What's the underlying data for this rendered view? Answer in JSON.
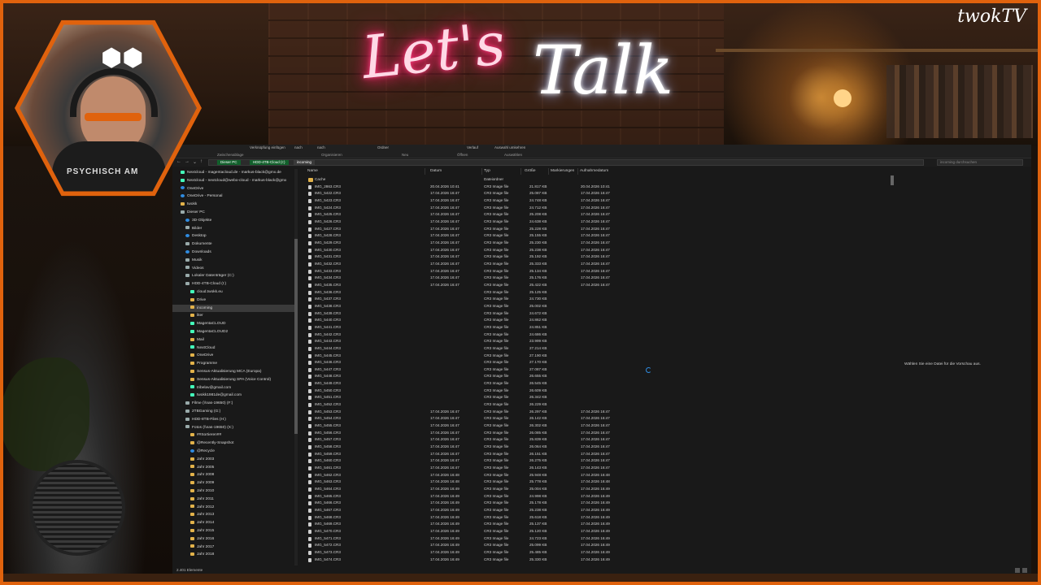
{
  "stream": {
    "title_lets": "Let's",
    "title_talk": "Talk",
    "logo": "twokTV",
    "cam_shirt_text": "PSYCHISCH AM",
    "accent_color": "#e0620d"
  },
  "ribbon": {
    "items": [
      {
        "label": "Verknüpfung einfügen"
      },
      {
        "label": "nach"
      },
      {
        "label": "nach"
      },
      {
        "label": "Ordner"
      },
      {
        "label": "Verlauf"
      },
      {
        "label": "Auswahl umkehren"
      }
    ],
    "groups": [
      {
        "label": "Zwischenablage"
      },
      {
        "label": "Organisieren"
      },
      {
        "label": "Neu"
      },
      {
        "label": "Öffnen"
      },
      {
        "label": "Auswählen"
      }
    ]
  },
  "address": {
    "crumbs": [
      "Dieser PC",
      "HDD-4TB-Cloud (I:)",
      "incoming"
    ],
    "search_placeholder": "incoming durchsuchen"
  },
  "nav": {
    "items": [
      {
        "label": "Nextcloud - magentacloud.de - markus-black@gmx.de",
        "icon": "cloud",
        "indent": 0
      },
      {
        "label": "Nextcloud - nextcloud@webo-cloud - markus-black@gmx",
        "icon": "cloud",
        "indent": 0
      },
      {
        "label": "OneDrive",
        "icon": "blue",
        "indent": 0
      },
      {
        "label": "OneDrive - Personal",
        "icon": "blue",
        "indent": 0
      },
      {
        "label": "twokk",
        "icon": "folder",
        "indent": 0
      },
      {
        "label": "Dieser PC",
        "icon": "drive",
        "indent": 0
      },
      {
        "label": "3D-Objekte",
        "icon": "blue",
        "indent": 1
      },
      {
        "label": "Bilder",
        "icon": "drive",
        "indent": 1
      },
      {
        "label": "Desktop",
        "icon": "blue",
        "indent": 1
      },
      {
        "label": "Dokumente",
        "icon": "drive",
        "indent": 1
      },
      {
        "label": "Downloads",
        "icon": "blue",
        "indent": 1
      },
      {
        "label": "Musik",
        "icon": "drive",
        "indent": 1
      },
      {
        "label": "Videos",
        "icon": "drive",
        "indent": 1
      },
      {
        "label": "Lokaler Datenträger (C:)",
        "icon": "drive",
        "indent": 1
      },
      {
        "label": "HDD-4TB-Cloud (I:)",
        "icon": "drive",
        "indent": 1
      },
      {
        "label": "cloud.twokk.eu",
        "icon": "cloud",
        "indent": 2
      },
      {
        "label": "Drive",
        "icon": "folder",
        "indent": 2
      },
      {
        "label": "incoming",
        "icon": "folder",
        "indent": 2,
        "selected": true
      },
      {
        "label": "liter",
        "icon": "folder",
        "indent": 2
      },
      {
        "label": "MagentaCLOUD",
        "icon": "cloud",
        "indent": 2
      },
      {
        "label": "MagentaCLOUD2",
        "icon": "cloud",
        "indent": 2
      },
      {
        "label": "Mail",
        "icon": "folder",
        "indent": 2
      },
      {
        "label": "NextCloud",
        "icon": "cloud",
        "indent": 2
      },
      {
        "label": "OneDrive",
        "icon": "folder",
        "indent": 2
      },
      {
        "label": "Programme",
        "icon": "folder",
        "indent": 2
      },
      {
        "label": "Sensus-Aktualisierung MCA (Europa)",
        "icon": "folder",
        "indent": 2
      },
      {
        "label": "Sensus-Aktualisierung SPA (Voice Control)",
        "icon": "folder",
        "indent": 2
      },
      {
        "label": "tribelav@gmail.com",
        "icon": "cloud",
        "indent": 2
      },
      {
        "label": "twokk1981de@gmail.com",
        "icon": "cloud",
        "indent": 2
      },
      {
        "label": "Filme (\\\\nas-19650) (F:)",
        "icon": "drive",
        "indent": 1
      },
      {
        "label": "2TBGaming (G:)",
        "icon": "drive",
        "indent": 1
      },
      {
        "label": "HDD-8TB-Files (H:)",
        "icon": "drive",
        "indent": 1
      },
      {
        "label": "Fotos (\\\\nas-19650) (X:)",
        "icon": "drive",
        "indent": 1
      },
      {
        "label": "##Sortieren##",
        "icon": "folder",
        "indent": 2
      },
      {
        "label": "@Recently-Snapshot",
        "icon": "folder",
        "indent": 2
      },
      {
        "label": "@Recycle",
        "icon": "blue",
        "indent": 2
      },
      {
        "label": "Jahr 2003",
        "icon": "folder",
        "indent": 2
      },
      {
        "label": "Jahr 2005",
        "icon": "folder",
        "indent": 2
      },
      {
        "label": "Jahr 2008",
        "icon": "folder",
        "indent": 2
      },
      {
        "label": "Jahr 2009",
        "icon": "folder",
        "indent": 2
      },
      {
        "label": "Jahr 2010",
        "icon": "folder",
        "indent": 2
      },
      {
        "label": "Jahr 2011",
        "icon": "folder",
        "indent": 2
      },
      {
        "label": "Jahr 2012",
        "icon": "folder",
        "indent": 2
      },
      {
        "label": "Jahr 2013",
        "icon": "folder",
        "indent": 2
      },
      {
        "label": "Jahr 2014",
        "icon": "folder",
        "indent": 2
      },
      {
        "label": "Jahr 2015",
        "icon": "folder",
        "indent": 2
      },
      {
        "label": "Jahr 2016",
        "icon": "folder",
        "indent": 2
      },
      {
        "label": "Jahr 2017",
        "icon": "folder",
        "indent": 2
      },
      {
        "label": "Jahr 2018",
        "icon": "folder",
        "indent": 2
      }
    ]
  },
  "columns": [
    "Name",
    "Datum",
    "Typ",
    "Größe",
    "Markierungen",
    "Aufnahmedatum"
  ],
  "files": [
    {
      "name": "Cache",
      "date": "",
      "type": "Dateiordner",
      "size": "",
      "taken": "",
      "folder": true
    },
    {
      "name": "IMG_2863.CR3",
      "date": "20.04.2026 10:41",
      "type": "CR3 Image file",
      "size": "21.817 KB",
      "taken": "20.04.2026 10:41"
    },
    {
      "name": "IMG_5422.CR3",
      "date": "17.04.2026 16:47",
      "type": "CR3 Image file",
      "size": "25.087 KB",
      "taken": "17.04.2026 16:47"
    },
    {
      "name": "IMG_5423.CR3",
      "date": "17.04.2026 16:47",
      "type": "CR3 Image file",
      "size": "24.748 KB",
      "taken": "17.04.2026 16:47"
    },
    {
      "name": "IMG_5424.CR3",
      "date": "17.04.2026 16:47",
      "type": "CR3 Image file",
      "size": "24.712 KB",
      "taken": "17.04.2026 16:47"
    },
    {
      "name": "IMG_5425.CR3",
      "date": "17.04.2026 16:47",
      "type": "CR3 Image file",
      "size": "25.208 KB",
      "taken": "17.04.2026 16:47"
    },
    {
      "name": "IMG_5426.CR3",
      "date": "17.04.2026 16:47",
      "type": "CR3 Image file",
      "size": "24.638 KB",
      "taken": "17.04.2026 16:47"
    },
    {
      "name": "IMG_5427.CR3",
      "date": "17.04.2026 16:47",
      "type": "CR3 Image file",
      "size": "25.228 KB",
      "taken": "17.04.2026 16:47"
    },
    {
      "name": "IMG_5428.CR3",
      "date": "17.04.2026 16:47",
      "type": "CR3 Image file",
      "size": "25.155 KB",
      "taken": "17.04.2026 16:47"
    },
    {
      "name": "IMG_5429.CR3",
      "date": "17.04.2026 16:47",
      "type": "CR3 Image file",
      "size": "25.230 KB",
      "taken": "17.04.2026 16:47"
    },
    {
      "name": "IMG_5430.CR3",
      "date": "17.04.2026 16:47",
      "type": "CR3 Image file",
      "size": "25.238 KB",
      "taken": "17.04.2026 16:47"
    },
    {
      "name": "IMG_5431.CR3",
      "date": "17.04.2026 16:47",
      "type": "CR3 Image file",
      "size": "25.192 KB",
      "taken": "17.04.2026 16:47"
    },
    {
      "name": "IMG_5432.CR3",
      "date": "17.04.2026 16:47",
      "type": "CR3 Image file",
      "size": "25.333 KB",
      "taken": "17.04.2026 16:47"
    },
    {
      "name": "IMG_5433.CR3",
      "date": "17.04.2026 16:47",
      "type": "CR3 Image file",
      "size": "25.134 KB",
      "taken": "17.04.2026 16:47"
    },
    {
      "name": "IMG_5434.CR3",
      "date": "17.04.2026 16:47",
      "type": "CR3 Image file",
      "size": "25.176 KB",
      "taken": "17.04.2026 16:47"
    },
    {
      "name": "IMG_5435.CR3",
      "date": "17.04.2026 16:47",
      "type": "CR3 Image file",
      "size": "25.422 KB",
      "taken": "17.04.2026 16:47"
    },
    {
      "name": "IMG_5436.CR3",
      "date": "",
      "type": "CR3 Image file",
      "size": "25.125 KB",
      "taken": ""
    },
    {
      "name": "IMG_5437.CR3",
      "date": "",
      "type": "CR3 Image file",
      "size": "24.730 KB",
      "taken": ""
    },
    {
      "name": "IMG_5438.CR3",
      "date": "",
      "type": "CR3 Image file",
      "size": "25.002 KB",
      "taken": ""
    },
    {
      "name": "IMG_5439.CR3",
      "date": "",
      "type": "CR3 Image file",
      "size": "24.672 KB",
      "taken": ""
    },
    {
      "name": "IMG_5440.CR3",
      "date": "",
      "type": "CR3 Image file",
      "size": "24.862 KB",
      "taken": ""
    },
    {
      "name": "IMG_5441.CR3",
      "date": "",
      "type": "CR3 Image file",
      "size": "24.851 KB",
      "taken": ""
    },
    {
      "name": "IMG_5442.CR3",
      "date": "",
      "type": "CR3 Image file",
      "size": "24.686 KB",
      "taken": ""
    },
    {
      "name": "IMG_5443.CR3",
      "date": "",
      "type": "CR3 Image file",
      "size": "23.999 KB",
      "taken": ""
    },
    {
      "name": "IMG_5444.CR3",
      "date": "",
      "type": "CR3 Image file",
      "size": "27.214 KB",
      "taken": ""
    },
    {
      "name": "IMG_5445.CR3",
      "date": "",
      "type": "CR3 Image file",
      "size": "27.190 KB",
      "taken": ""
    },
    {
      "name": "IMG_5446.CR3",
      "date": "",
      "type": "CR3 Image file",
      "size": "27.170 KB",
      "taken": ""
    },
    {
      "name": "IMG_5447.CR3",
      "date": "",
      "type": "CR3 Image file",
      "size": "27.087 KB",
      "taken": ""
    },
    {
      "name": "IMG_5448.CR3",
      "date": "",
      "type": "CR3 Image file",
      "size": "26.655 KB",
      "taken": ""
    },
    {
      "name": "IMG_5449.CR3",
      "date": "",
      "type": "CR3 Image file",
      "size": "26.545 KB",
      "taken": ""
    },
    {
      "name": "IMG_5450.CR3",
      "date": "",
      "type": "CR3 Image file",
      "size": "26.609 KB",
      "taken": ""
    },
    {
      "name": "IMG_5451.CR3",
      "date": "",
      "type": "CR3 Image file",
      "size": "26.342 KB",
      "taken": ""
    },
    {
      "name": "IMG_5452.CR3",
      "date": "",
      "type": "CR3 Image file",
      "size": "26.229 KB",
      "taken": ""
    },
    {
      "name": "IMG_5453.CR3",
      "date": "17.04.2026 16:47",
      "type": "CR3 Image file",
      "size": "26.297 KB",
      "taken": "17.04.2026 16:47"
    },
    {
      "name": "IMG_5454.CR3",
      "date": "17.04.2026 16:47",
      "type": "CR3 Image file",
      "size": "26.142 KB",
      "taken": "17.04.2026 16:47"
    },
    {
      "name": "IMG_5455.CR3",
      "date": "17.04.2026 16:47",
      "type": "CR3 Image file",
      "size": "26.302 KB",
      "taken": "17.04.2026 16:47"
    },
    {
      "name": "IMG_5456.CR3",
      "date": "17.04.2026 16:47",
      "type": "CR3 Image file",
      "size": "26.085 KB",
      "taken": "17.04.2026 16:47"
    },
    {
      "name": "IMG_5457.CR3",
      "date": "17.04.2026 16:47",
      "type": "CR3 Image file",
      "size": "25.839 KB",
      "taken": "17.04.2026 16:47"
    },
    {
      "name": "IMG_5458.CR3",
      "date": "17.04.2026 16:47",
      "type": "CR3 Image file",
      "size": "26.064 KB",
      "taken": "17.04.2026 16:47"
    },
    {
      "name": "IMG_5459.CR3",
      "date": "17.04.2026 16:47",
      "type": "CR3 Image file",
      "size": "26.151 KB",
      "taken": "17.04.2026 16:47"
    },
    {
      "name": "IMG_5460.CR3",
      "date": "17.04.2026 16:47",
      "type": "CR3 Image file",
      "size": "26.275 KB",
      "taken": "17.04.2026 16:47"
    },
    {
      "name": "IMG_5461.CR3",
      "date": "17.04.2026 16:47",
      "type": "CR3 Image file",
      "size": "26.143 KB",
      "taken": "17.04.2026 16:47"
    },
    {
      "name": "IMG_5462.CR3",
      "date": "17.04.2026 16:48",
      "type": "CR3 Image file",
      "size": "25.948 KB",
      "taken": "17.04.2026 16:48"
    },
    {
      "name": "IMG_5463.CR3",
      "date": "17.04.2026 16:48",
      "type": "CR3 Image file",
      "size": "25.778 KB",
      "taken": "17.04.2026 16:48"
    },
    {
      "name": "IMG_5464.CR3",
      "date": "17.04.2026 16:49",
      "type": "CR3 Image file",
      "size": "25.004 KB",
      "taken": "17.04.2026 16:49"
    },
    {
      "name": "IMG_5465.CR3",
      "date": "17.04.2026 16:49",
      "type": "CR3 Image file",
      "size": "24.998 KB",
      "taken": "17.04.2026 16:49"
    },
    {
      "name": "IMG_5466.CR3",
      "date": "17.04.2026 16:49",
      "type": "CR3 Image file",
      "size": "25.178 KB",
      "taken": "17.04.2026 16:49"
    },
    {
      "name": "IMG_5467.CR3",
      "date": "17.04.2026 16:49",
      "type": "CR3 Image file",
      "size": "25.238 KB",
      "taken": "17.04.2026 16:49"
    },
    {
      "name": "IMG_5468.CR3",
      "date": "17.04.2026 16:49",
      "type": "CR3 Image file",
      "size": "25.618 KB",
      "taken": "17.04.2026 16:49"
    },
    {
      "name": "IMG_5469.CR3",
      "date": "17.04.2026 16:49",
      "type": "CR3 Image file",
      "size": "25.137 KB",
      "taken": "17.04.2026 16:49"
    },
    {
      "name": "IMG_5470.CR3",
      "date": "17.04.2026 16:49",
      "type": "CR3 Image file",
      "size": "25.120 KB",
      "taken": "17.04.2026 16:49"
    },
    {
      "name": "IMG_5471.CR3",
      "date": "17.04.2026 16:49",
      "type": "CR3 Image file",
      "size": "24.723 KB",
      "taken": "17.04.2026 16:49"
    },
    {
      "name": "IMG_5472.CR3",
      "date": "17.04.2026 16:49",
      "type": "CR3 Image file",
      "size": "25.099 KB",
      "taken": "17.04.2026 16:49"
    },
    {
      "name": "IMG_5473.CR3",
      "date": "17.04.2026 16:49",
      "type": "CR3 Image file",
      "size": "25.485 KB",
      "taken": "17.04.2026 16:49"
    },
    {
      "name": "IMG_5474.CR3",
      "date": "17.04.2026 16:49",
      "type": "CR3 Image file",
      "size": "25.330 KB",
      "taken": "17.04.2026 16:49"
    }
  ],
  "preview_text": "Wählen Sie eine Datei für die Vorschau aus.",
  "status_text": "2.401 Elemente"
}
